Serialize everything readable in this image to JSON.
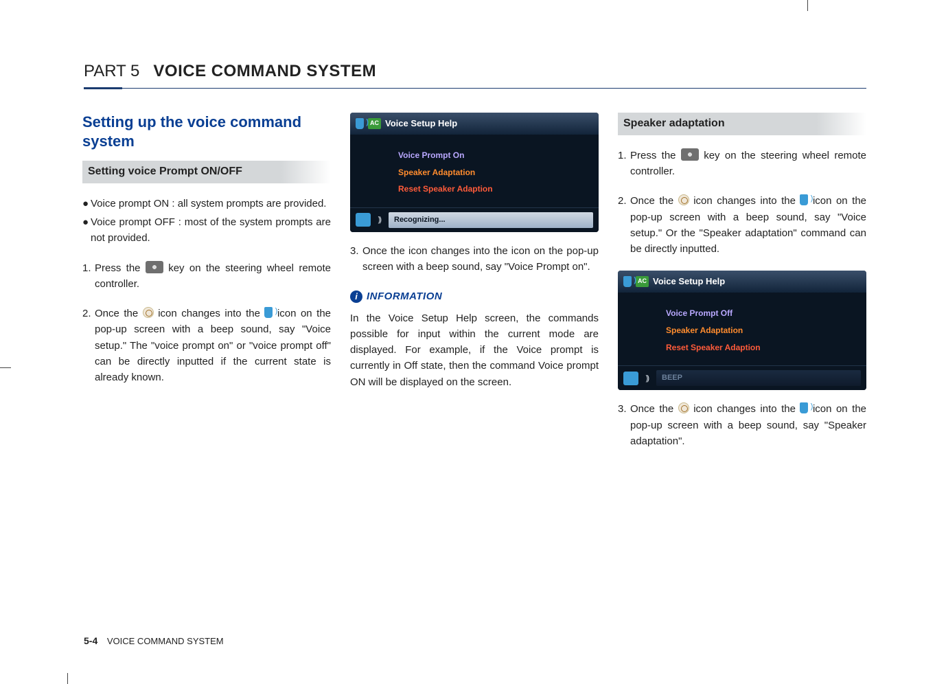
{
  "header": {
    "part_label": "PART 5",
    "title": "VOICE COMMAND SYSTEM"
  },
  "col1": {
    "section_title": "Setting up the voice command system",
    "sub_heading": "Setting voice Prompt ON/OFF",
    "bullet1": "Voice prompt ON : all system prompts are provided.",
    "bullet2": "Voice prompt OFF : most of the system prompts are not provided.",
    "step1_a": "Press the ",
    "step1_b": " key on the steering wheel remote controller.",
    "step2_a": "Once the  ",
    "step2_b": "  icon changes into the ",
    "step2_c": " icon on the pop-up screen with a beep sound, say \"Voice setup.\" The \"voice prompt on\" or \"voice prompt off\" can be directly inputted if the current state is already known."
  },
  "col2": {
    "shot": {
      "title": "Voice Setup Help",
      "row1": "Voice Prompt On",
      "row2": "Speaker Adaptation",
      "row3": "Reset Speaker Adaption",
      "footer": "Recognizing..."
    },
    "step3": "Once the  icon changes into the icon on the pop-up screen with a beep sound, say \"Voice Prompt on\".",
    "info_label": "INFORMATION",
    "info_body": "In the Voice Setup Help screen, the commands possible for input within the current mode are displayed. For example, if the Voice prompt is currently in Off state, then the command Voice prompt ON will be displayed on the screen."
  },
  "col3": {
    "sub_heading": "Speaker adaptation",
    "step1_a": "Press the ",
    "step1_b": " key on the steering wheel remote controller.",
    "step2_a": "Once the ",
    "step2_b": " icon changes into the ",
    "step2_c": " icon on the pop-up screen with a beep sound, say \"Voice setup.\" Or the \"Speaker adaptation\" command can be directly inputted.",
    "shot": {
      "title": "Voice Setup Help",
      "row1": "Voice Prompt Off",
      "row2": "Speaker Adaptation",
      "row3": "Reset Speaker Adaption",
      "footer": "BEEP"
    },
    "step3_a": "Once the ",
    "step3_b": " icon changes into the ",
    "step3_c": " icon on the pop-up screen with a beep sound, say \"Speaker adaptation\"."
  },
  "footer": {
    "page": "5-4",
    "section": "VOICE COMMAND SYSTEM"
  }
}
